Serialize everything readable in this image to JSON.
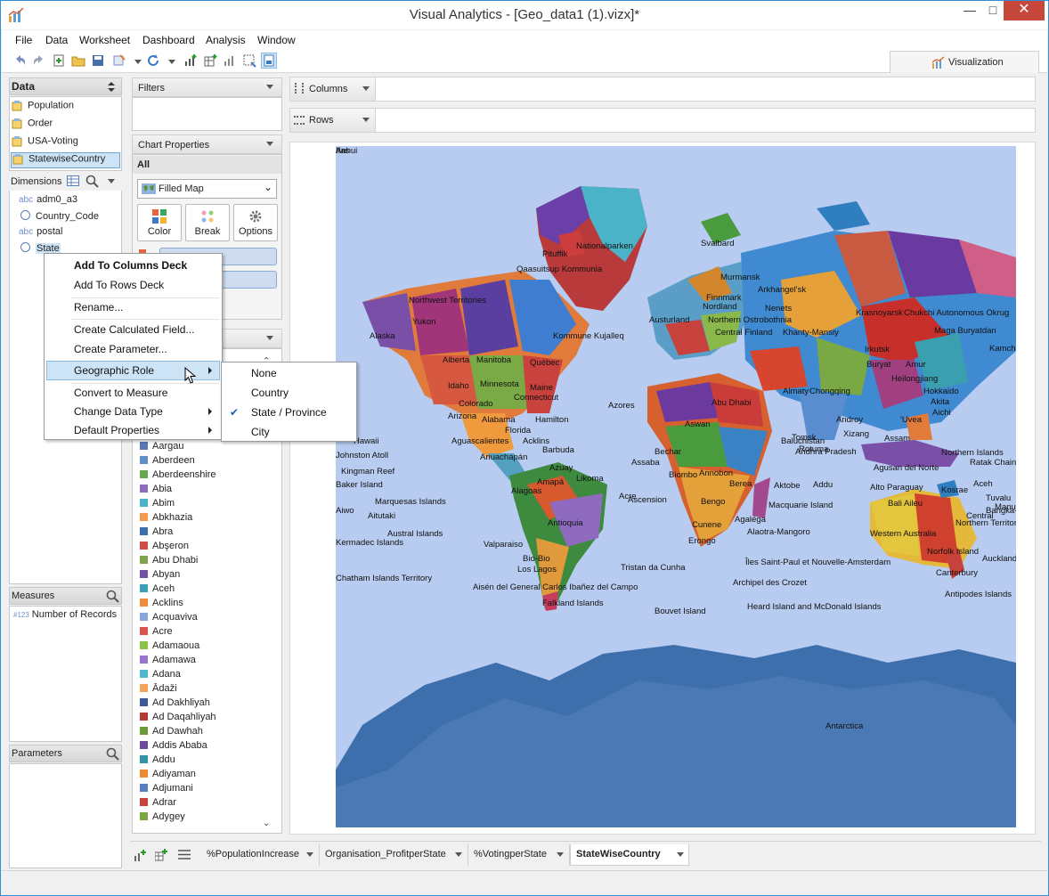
{
  "window": {
    "title": "Visual Analytics - [Geo_data1 (1).vizx]*"
  },
  "menu": [
    "File",
    "Data",
    "Worksheet",
    "Dashboard",
    "Analysis",
    "Window"
  ],
  "viz_tab": "Visualization",
  "data_panel": {
    "title": "Data",
    "sources": [
      "Population",
      "Order",
      "USA-Voting",
      "StatewiseCountry"
    ],
    "dimensions_title": "Dimensions",
    "dimensions": [
      {
        "type": "abc",
        "label": "adm0_a3"
      },
      {
        "type": "globe",
        "label": "Country_Code"
      },
      {
        "type": "abc",
        "label": "postal"
      },
      {
        "type": "globe",
        "label": "State"
      }
    ],
    "measures_title": "Measures",
    "measures": [
      {
        "type": "#123",
        "label": "Number of Records"
      }
    ],
    "parameters_title": "Parameters"
  },
  "filters": {
    "title": "Filters"
  },
  "chart_properties": {
    "title": "Chart Properties",
    "all_label": "All",
    "chart_type": "Filled Map",
    "buttons": [
      "Color",
      "Break",
      "Options"
    ]
  },
  "legend_items": [
    {
      "label": "Aargau",
      "color": "#5a78b8"
    },
    {
      "label": "Aberdeen",
      "color": "#5f8ec9"
    },
    {
      "label": "Aberdeenshire",
      "color": "#6aa84f"
    },
    {
      "label": "Abia",
      "color": "#8e6bbf"
    },
    {
      "label": "Abim",
      "color": "#4bb3c8"
    },
    {
      "label": "Abkhazia",
      "color": "#f39a50"
    },
    {
      "label": "Abra",
      "color": "#3e6fad"
    },
    {
      "label": "Abşeron",
      "color": "#cf4c47"
    },
    {
      "label": "Abu Dhabi",
      "color": "#7ea44b"
    },
    {
      "label": "Abyan",
      "color": "#7053a8"
    },
    {
      "label": "Aceh",
      "color": "#3d9fb5"
    },
    {
      "label": "Acklins",
      "color": "#f28a3e"
    },
    {
      "label": "Acquaviva",
      "color": "#87a6da"
    },
    {
      "label": "Acre",
      "color": "#d9534f"
    },
    {
      "label": "Adamaoua",
      "color": "#8bc34a"
    },
    {
      "label": "Adamawa",
      "color": "#9575cd"
    },
    {
      "label": "Adana",
      "color": "#4fb8cf"
    },
    {
      "label": "Ādaži",
      "color": "#f5a25c"
    },
    {
      "label": "Ad Dakhliyah",
      "color": "#3b5998"
    },
    {
      "label": "Ad Daqahliyah",
      "color": "#b53a36"
    },
    {
      "label": "Ad Dawhah",
      "color": "#6b9a3b"
    },
    {
      "label": "Addis Ababa",
      "color": "#6c4a9e"
    },
    {
      "label": "Addu",
      "color": "#3394a8"
    },
    {
      "label": "Adiyaman",
      "color": "#ee8a2f"
    },
    {
      "label": "Adjumani",
      "color": "#5a7fc0"
    },
    {
      "label": "Adrar",
      "color": "#c9413c"
    },
    {
      "label": "Adygey",
      "color": "#7ba640"
    }
  ],
  "shelves": {
    "columns": "Columns",
    "rows": "Rows"
  },
  "context_menu": {
    "items": [
      "Add To Columns Deck",
      "Add To Rows Deck",
      "Rename...",
      "Create Calculated Field...",
      "Create Parameter...",
      "Geographic Role",
      "Convert to Measure",
      "Change Data Type",
      "Default Properties"
    ],
    "submenu": [
      "None",
      "Country",
      "State / Province",
      "City"
    ],
    "checked": "State / Province"
  },
  "sheet_tabs": [
    "%PopulationIncrease",
    "Organisation_ProfitperState",
    "%VotingperState",
    "StateWiseCountry"
  ],
  "active_sheet": "StateWiseCountry",
  "map_labels": [
    {
      "t": "Nationalparken"
    },
    {
      "t": "Pituffik"
    },
    {
      "t": "Qaasuitsup Kommunia"
    },
    {
      "t": "Svalbard"
    },
    {
      "t": "Murmansk"
    },
    {
      "t": "Arkhangel'sk"
    },
    {
      "t": "Nenets"
    },
    {
      "t": "Krasnoyarsk"
    },
    {
      "t": "Chukchi Autonomous Okrug"
    },
    {
      "t": "Maga Buryatdan"
    },
    {
      "t": "Kamchatka"
    },
    {
      "t": "Northwest Territories"
    },
    {
      "t": "Yukon"
    },
    {
      "t": "Alaska"
    },
    {
      "t": "Alberta"
    },
    {
      "t": "Manitoba"
    },
    {
      "t": "Québec"
    },
    {
      "t": "Kommune Kujalleq"
    },
    {
      "t": "Austurland"
    },
    {
      "t": "Nordland"
    },
    {
      "t": "Finnmark"
    },
    {
      "t": "Northern Ostrobothnia"
    },
    {
      "t": "Central Finland"
    },
    {
      "t": "Khanty-Mansiy"
    },
    {
      "t": "Irkutsk"
    },
    {
      "t": "Buryat"
    },
    {
      "t": "Amur"
    },
    {
      "t": "Heilongjiang"
    },
    {
      "t": "Hokkaido"
    },
    {
      "t": "Akita"
    },
    {
      "t": "Aichi"
    },
    {
      "t": "Idaho"
    },
    {
      "t": "Minnesota"
    },
    {
      "t": "Maine"
    },
    {
      "t": "Connecticut"
    },
    {
      "t": "Colorado"
    },
    {
      "t": "Arizona"
    },
    {
      "t": "Alabama"
    },
    {
      "t": "Florida"
    },
    {
      "t": "Hamilton"
    },
    {
      "t": "Azores"
    },
    {
      "t": "Aguascalientes"
    },
    {
      "t": "Acklins"
    },
    {
      "t": "Barbuda"
    },
    {
      "t": "Anuachapán"
    },
    {
      "t": "Hawaii"
    },
    {
      "t": "Johnston Atoll"
    },
    {
      "t": "Kingman Reef"
    },
    {
      "t": "Baker Island"
    },
    {
      "t": "Marquesas Islands"
    },
    {
      "t": "Tuvalu"
    },
    {
      "t": "Aitutaki"
    },
    {
      "t": "Austral Islands"
    },
    {
      "t": "Kermadec Islands"
    },
    {
      "t": "Valparaiso"
    },
    {
      "t": "Bio-Bio"
    },
    {
      "t": "Los Lagos"
    },
    {
      "t": "Chatham Islands Territory"
    },
    {
      "t": "Aisén del General Carlos Ibañez del Campo"
    },
    {
      "t": "Falkland Islands"
    },
    {
      "t": "Tristan da Cunha"
    },
    {
      "t": "Ascension"
    },
    {
      "t": "Bouvet Island"
    },
    {
      "t": "Îles Saint-Paul et Nouvelle-Amsterdam"
    },
    {
      "t": "Archipel des Crozet"
    },
    {
      "t": "Heard Island and McDonald Islands"
    },
    {
      "t": "Antarctica"
    },
    {
      "t": "Andhra Pradesh"
    },
    {
      "t": "Addu"
    },
    {
      "t": "Agusan del Norte"
    },
    {
      "t": "Northern Islands"
    },
    {
      "t": "Ratak Chain"
    },
    {
      "t": "Kosrae"
    },
    {
      "t": "Manus"
    },
    {
      "t": "Central"
    },
    {
      "t": "Bali Aileu"
    },
    {
      "t": "Northern Territory"
    },
    {
      "t": "Western Australia"
    },
    {
      "t": "Norfolk Island"
    },
    {
      "t": "Auckland"
    },
    {
      "t": "Canterbury"
    },
    {
      "t": "Antipodes Islands"
    },
    {
      "t": "Macquarie Island"
    },
    {
      "t": "Agaléga"
    },
    {
      "t": "Alaotra-Mangoro"
    },
    {
      "t": "Androy"
    },
    {
      "t": "Xizang"
    },
    {
      "t": "Assam"
    },
    {
      "t": "Chongqing"
    },
    {
      "t": "Almaty"
    },
    {
      "t": "Aktobe"
    },
    {
      "t": "Tomsk"
    },
    {
      "t": "Baluchistan"
    },
    {
      "t": "Abu Dhabi"
    },
    {
      "t": "Aswan"
    },
    {
      "t": "Bechar"
    },
    {
      "t": "Assaba"
    },
    {
      "t": "Biombo"
    },
    {
      "t": "Annobon"
    },
    {
      "t": "Bengo"
    },
    {
      "t": "Cunene"
    },
    {
      "t": "Erongo"
    },
    {
      "t": "Berea"
    },
    {
      "t": "Likoma"
    },
    {
      "t": "Amapá"
    },
    {
      "t": "Acre"
    },
    {
      "t": "Alagoas"
    },
    {
      "t": "Azuay"
    },
    {
      "t": "Antioquia"
    },
    {
      "t": "Alto Paraguay"
    },
    {
      "t": "Aceh"
    },
    {
      "t": "Bangka-Belitung"
    },
    {
      "t": "Aiwo"
    },
    {
      "t": "Rotuma"
    },
    {
      "t": "'Uvea"
    },
    {
      "t": "Ifas"
    },
    {
      "t": "Anhui"
    }
  ]
}
